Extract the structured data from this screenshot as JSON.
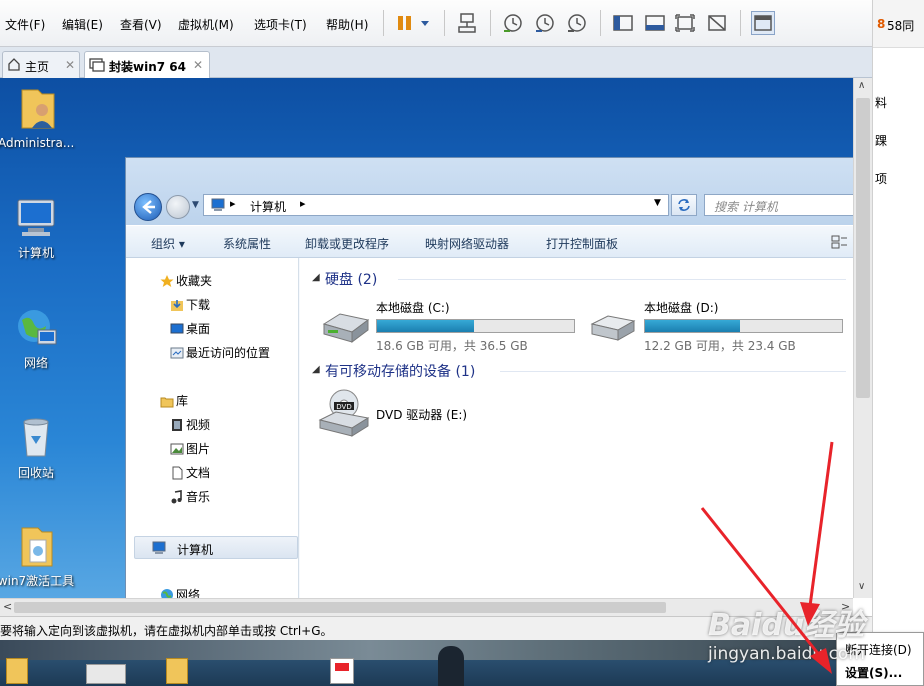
{
  "menubar": {
    "items": [
      "文件(F)",
      "编辑(E)",
      "查看(V)",
      "虚拟机(M)",
      "选项卡(T)",
      "帮助(H)"
    ]
  },
  "tabs": [
    {
      "label": "主页",
      "active": false
    },
    {
      "label": "封装win7 64",
      "active": true
    }
  ],
  "right_panel": {
    "top_text": "58同",
    "side_texts": [
      "料",
      "踝",
      "项"
    ]
  },
  "desktop_icons": [
    {
      "label": "Administra...",
      "icon": "user-folder-icon"
    },
    {
      "label": "计算机",
      "icon": "computer-icon"
    },
    {
      "label": "网络",
      "icon": "network-icon"
    },
    {
      "label": "回收站",
      "icon": "recycle-bin-icon"
    },
    {
      "label": "win7激活工具",
      "icon": "folder-icon"
    }
  ],
  "explorer": {
    "address": {
      "path": [
        "计算机"
      ],
      "search_placeholder": "搜索 计算机"
    },
    "commands": [
      "组织 ▾",
      "系统属性",
      "卸载或更改程序",
      "映射网络驱动器",
      "打开控制面板"
    ],
    "nav": {
      "favorites": {
        "title": "收藏夹",
        "items": [
          "下载",
          "桌面",
          "最近访问的位置"
        ]
      },
      "libraries": {
        "title": "库",
        "items": [
          "视频",
          "图片",
          "文档",
          "音乐"
        ]
      },
      "computer": "计算机",
      "network": "网络"
    },
    "groups": {
      "hard_disks": {
        "title": "硬盘 (2)",
        "drives": [
          {
            "name": "本地磁盘 (C:)",
            "free_text": "18.6 GB 可用，共 36.5 GB",
            "used_fraction": 0.49
          },
          {
            "name": "本地磁盘 (D:)",
            "free_text": "12.2 GB 可用，共 23.4 GB",
            "used_fraction": 0.48
          }
        ]
      },
      "removable": {
        "title": "有可移动存储的设备 (1)",
        "devices": [
          {
            "name": "DVD 驱动器 (E:)",
            "icon_text": "DVD"
          }
        ]
      }
    }
  },
  "status": {
    "text": "要将输入定向到该虚拟机，请在虚拟机内部单击或按 Ctrl+G。"
  },
  "context_menu": {
    "items": [
      "断开连接(D)",
      "设置(S)..."
    ]
  },
  "watermark": {
    "brand": "Baidu经验",
    "url": "jingyan.baidu.com"
  },
  "colors": {
    "accent": "#1e3287",
    "drive_bar": "#1b7fb0",
    "arrow": "#e8232a"
  }
}
